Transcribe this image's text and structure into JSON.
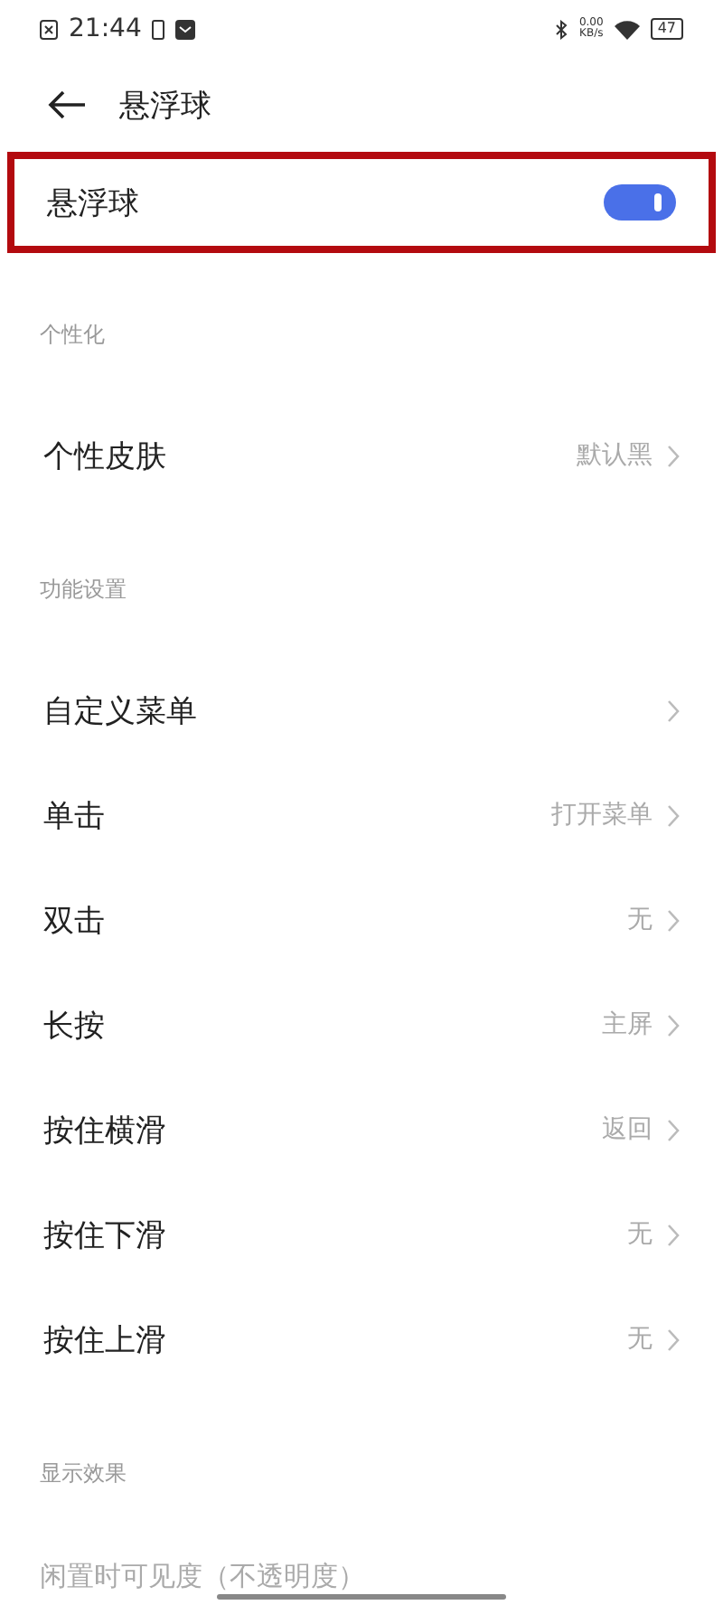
{
  "status_bar": {
    "time": "21:44",
    "net_speed": "0.00",
    "net_unit": "KB/s",
    "battery": "47"
  },
  "header": {
    "title": "悬浮球"
  },
  "main_toggle": {
    "label": "悬浮球",
    "on": true,
    "highlighted": true
  },
  "sections": [
    {
      "title": "个性化",
      "rows": [
        {
          "kind": "nav",
          "label": "个性皮肤",
          "value": "默认黑"
        }
      ]
    },
    {
      "title": "功能设置",
      "rows": [
        {
          "kind": "nav",
          "label": "自定义菜单"
        },
        {
          "kind": "nav",
          "label": "单击",
          "value": "打开菜单"
        },
        {
          "kind": "nav",
          "label": "双击",
          "value": "无"
        },
        {
          "kind": "nav",
          "label": "长按",
          "value": "主屏"
        },
        {
          "kind": "nav",
          "label": "按住横滑",
          "value": "返回"
        },
        {
          "kind": "nav",
          "label": "按住下滑",
          "value": "无"
        },
        {
          "kind": "nav",
          "label": "按住上滑",
          "value": "无"
        }
      ]
    },
    {
      "title": "显示效果",
      "rows": [
        {
          "kind": "caption",
          "label": "闲置时可见度（不透明度）"
        }
      ]
    }
  ]
}
